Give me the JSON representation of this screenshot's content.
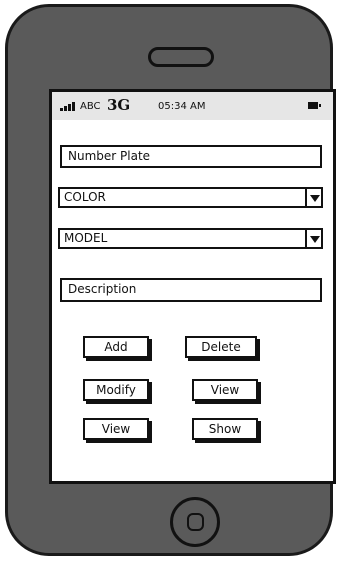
{
  "status_bar": {
    "carrier": "ABC",
    "network": "3G",
    "time": "05:34 AM",
    "icons": [
      "signal-bars-icon",
      "battery-icon"
    ]
  },
  "form": {
    "number_plate": "Number Plate",
    "color": "COLOR",
    "model": "MODEL",
    "description": "Description"
  },
  "buttons": {
    "add": "Add",
    "delete": "Delete",
    "modify": "Modify",
    "view_right": "View",
    "view_left": "View",
    "show": "Show"
  }
}
